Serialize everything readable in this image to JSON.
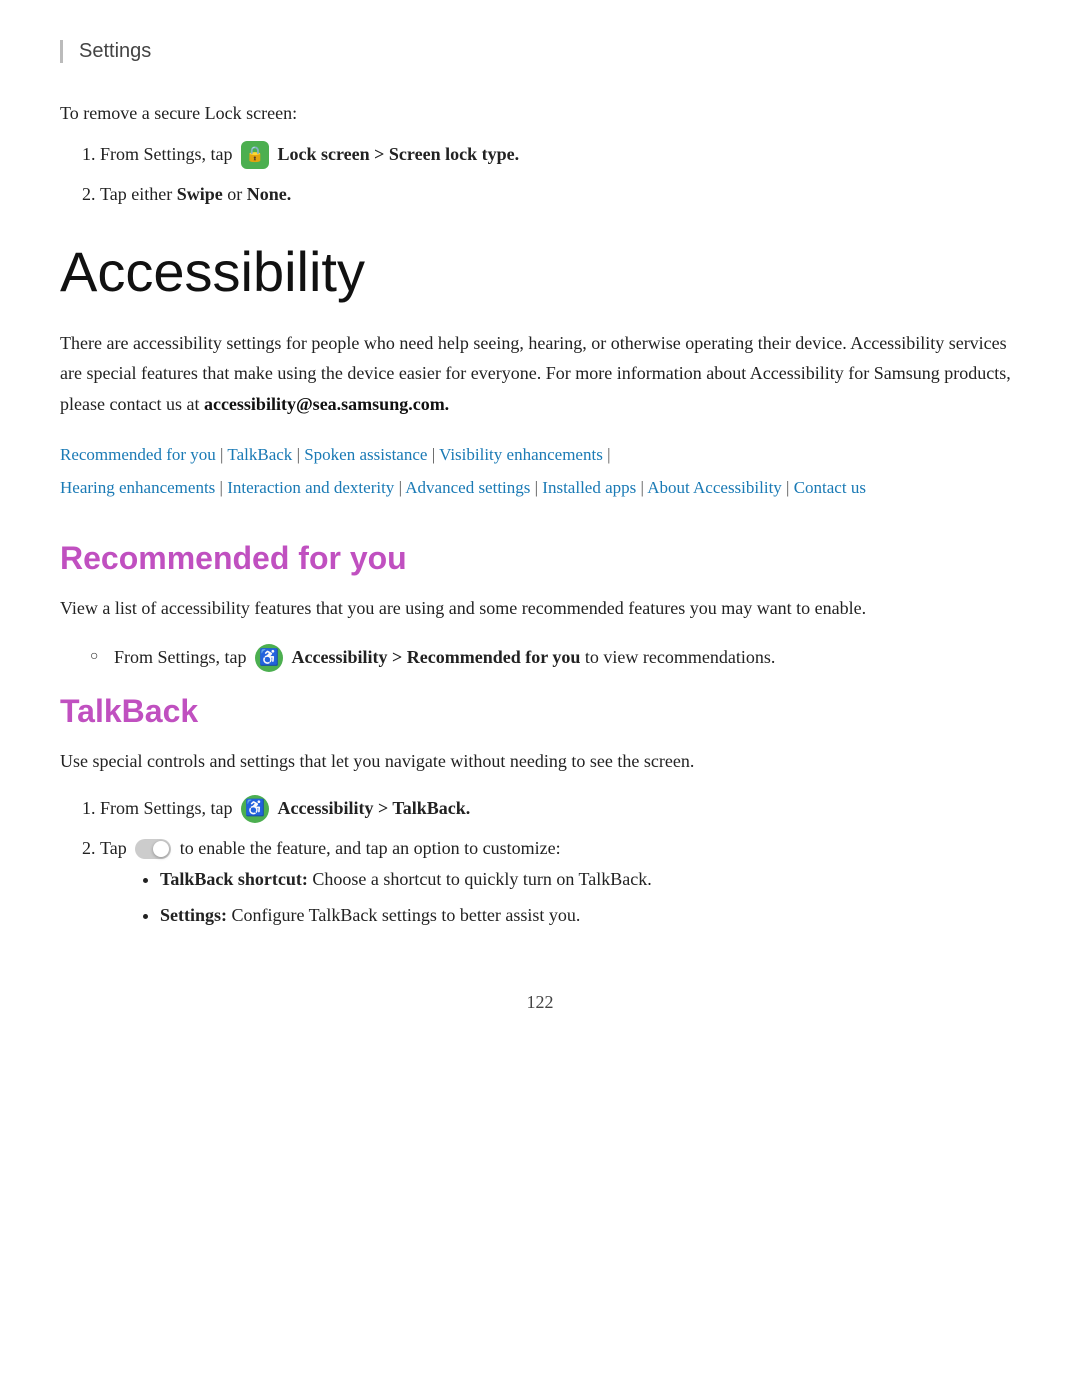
{
  "header": {
    "title": "Settings"
  },
  "intro": {
    "remove_lock_text": "To remove a secure Lock screen:",
    "steps": [
      {
        "id": 1,
        "prefix": "From Settings, tap",
        "bold": "Lock screen > Screen lock type.",
        "has_icon": true,
        "icon_type": "lock"
      },
      {
        "id": 2,
        "text_prefix": "Tap either ",
        "bold1": "Swipe",
        "text_middle": " or ",
        "bold2": "None.",
        "text_suffix": ""
      }
    ]
  },
  "accessibility": {
    "title": "Accessibility",
    "description": "There are accessibility settings for people who need help seeing, hearing, or otherwise operating their device. Accessibility services are special features that make using the device easier for everyone. For more information about Accessibility for Samsung products, please contact us at",
    "email": "accessibility@sea.samsung.com.",
    "nav_links": [
      {
        "text": "Recommended for you",
        "active": true
      },
      {
        "text": "TalkBack",
        "active": true
      },
      {
        "text": "Spoken assistance",
        "active": true
      },
      {
        "text": "Visibility enhancements",
        "active": true
      },
      {
        "text": "Hearing enhancements",
        "active": true
      },
      {
        "text": "Interaction and dexterity",
        "active": true
      },
      {
        "text": "Advanced settings",
        "active": true
      },
      {
        "text": "Installed apps",
        "active": true
      },
      {
        "text": "About Accessibility",
        "active": true
      },
      {
        "text": "Contact us",
        "active": true
      }
    ]
  },
  "recommended_section": {
    "heading": "Recommended for you",
    "description": "View a list of accessibility features that you are using and some recommended features you may want to enable.",
    "steps": [
      {
        "text_prefix": "From Settings, tap",
        "bold": "Accessibility > Recommended for you",
        "text_suffix": "to view recommendations.",
        "icon_type": "accessibility",
        "has_icon": true
      }
    ]
  },
  "talkback_section": {
    "heading": "TalkBack",
    "description": "Use special controls and settings that let you navigate without needing to see the screen.",
    "steps": [
      {
        "id": 1,
        "text_prefix": "From Settings, tap",
        "bold": "Accessibility > TalkBack.",
        "icon_type": "accessibility",
        "has_icon": true
      },
      {
        "id": 2,
        "text_prefix": "Tap",
        "text_suffix": "to enable the feature, and tap an option to customize:",
        "has_toggle": true
      }
    ],
    "sub_bullets": [
      {
        "bold": "TalkBack shortcut:",
        "text": "Choose a shortcut to quickly turn on TalkBack."
      },
      {
        "bold": "Settings:",
        "text": "Configure TalkBack settings to better assist you."
      }
    ]
  },
  "page_number": "122"
}
